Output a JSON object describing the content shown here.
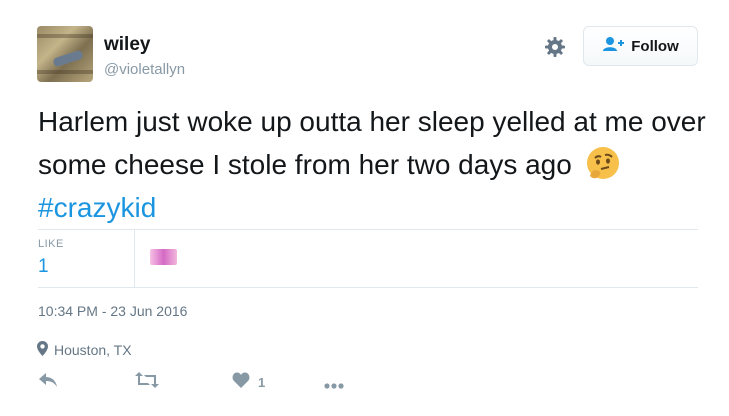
{
  "user": {
    "name": "wiley",
    "handle": "@violetallyn"
  },
  "header": {
    "follow_label": "Follow",
    "settings_icon": "gear-icon",
    "follow_icon": "add-user-icon"
  },
  "tweet": {
    "text": "Harlem just woke up outta her sleep yelled at me over some cheese I stole from her two days ago",
    "emoji": "🤔",
    "hashtag": "#crazykid"
  },
  "stats": {
    "like_label": "LIKE",
    "like_count": "1"
  },
  "meta": {
    "timestamp": "10:34 PM - 23 Jun 2016",
    "location": "Houston, TX"
  },
  "actions": {
    "reply_icon": "reply-icon",
    "retweet_icon": "retweet-icon",
    "like_icon": "heart-icon",
    "like_count": "1",
    "more_icon": "more-icon"
  },
  "colors": {
    "link": "#1b95e0",
    "muted": "#8899a6",
    "text": "#14171a"
  }
}
